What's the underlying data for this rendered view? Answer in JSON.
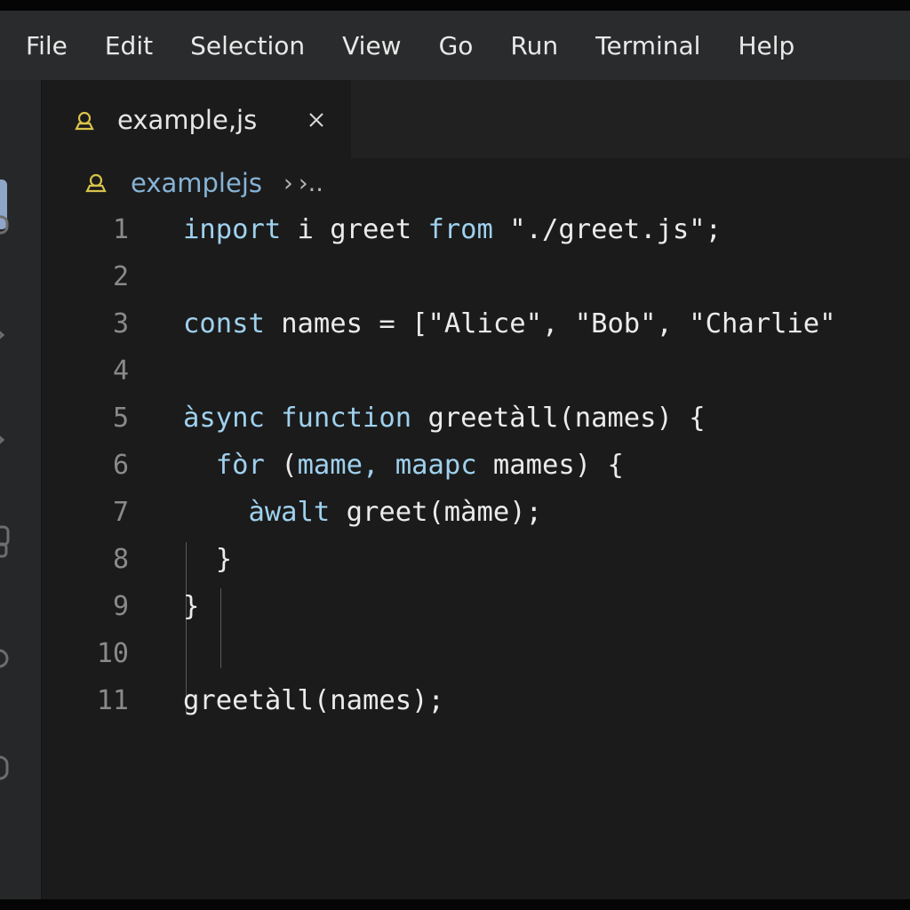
{
  "menu": [
    "File",
    "Edit",
    "Selection",
    "View",
    "Go",
    "Run",
    "Terminal",
    "Help"
  ],
  "tab": {
    "label": "example,js",
    "icon": "js-file-icon",
    "close_icon": "close-icon"
  },
  "breadcrumb": {
    "file": "examplejs",
    "separator": "›",
    "more": "›.."
  },
  "activity_icons": [
    "explorer-icon",
    "search-icon",
    "source-control-icon",
    "run-debug-icon",
    "extensions-icon",
    "remote-icon",
    "account-icon"
  ],
  "code_lines": [
    {
      "n": "1",
      "parts": [
        {
          "t": "inport",
          "c": "kw"
        },
        {
          "t": " i greet ",
          "c": "tx"
        },
        {
          "t": "from",
          "c": "kw"
        },
        {
          "t": " \"./greet.js\";",
          "c": "st"
        }
      ]
    },
    {
      "n": "2",
      "parts": []
    },
    {
      "n": "3",
      "parts": [
        {
          "t": "const",
          "c": "kw"
        },
        {
          "t": " names = [\"Alice\", \"Bob\", \"Charlie\"",
          "c": "tx"
        }
      ]
    },
    {
      "n": "4",
      "parts": []
    },
    {
      "n": "5",
      "parts": [
        {
          "t": "àsync function",
          "c": "kw"
        },
        {
          "t": " greetàll(names) {",
          "c": "tx"
        }
      ]
    },
    {
      "n": "6",
      "parts": [
        {
          "t": "  fòr",
          "c": "kw"
        },
        {
          "t": " (",
          "c": "tx"
        },
        {
          "t": "mame, maapc",
          "c": "kw"
        },
        {
          "t": " mames) {",
          "c": "tx"
        }
      ]
    },
    {
      "n": "7",
      "parts": [
        {
          "t": "    àwalt",
          "c": "kw"
        },
        {
          "t": " greet(màme);",
          "c": "tx"
        }
      ]
    },
    {
      "n": "8",
      "parts": [
        {
          "t": "  }",
          "c": "tx"
        }
      ]
    },
    {
      "n": "9",
      "parts": [
        {
          "t": "}",
          "c": "tx"
        }
      ]
    },
    {
      "n": "10",
      "parts": []
    },
    {
      "n": "11",
      "parts": [
        {
          "t": "greetàll(names);",
          "c": "tx"
        }
      ]
    }
  ],
  "colors": {
    "menubar_bg": "#2a2b2c",
    "editor_bg": "#1b1b1b",
    "keyword": "#9fd1ee",
    "text": "#ebebeb",
    "line_number": "#8a8a8a",
    "breadcrumb_file": "#86b3d6",
    "js_icon": "#d8c24a"
  }
}
